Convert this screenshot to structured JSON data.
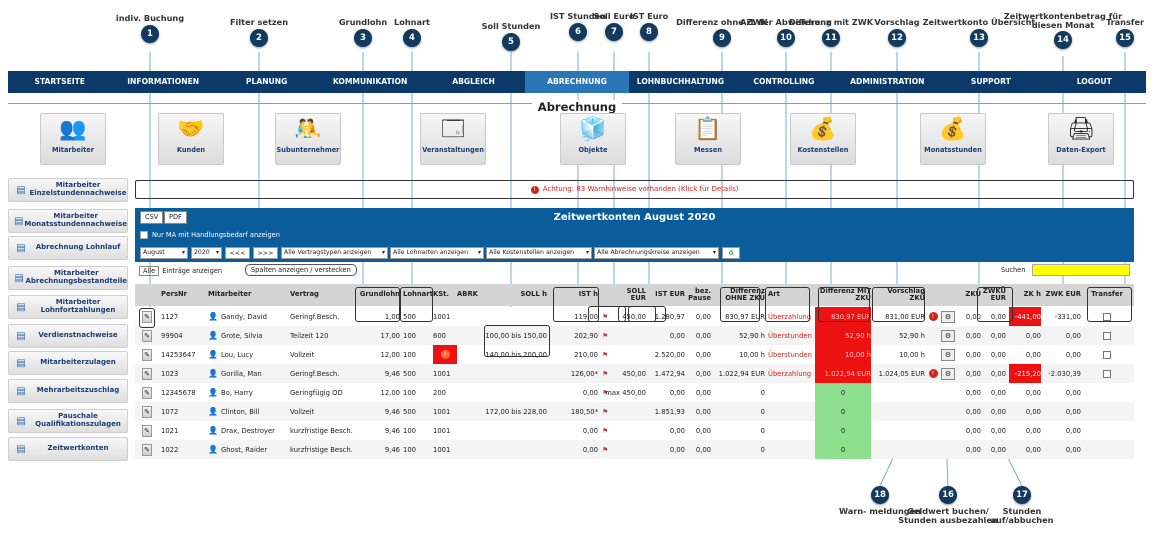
{
  "callouts": [
    {
      "num": "1",
      "label": "indiv. Buchung"
    },
    {
      "num": "2",
      "label": "Filter setzen"
    },
    {
      "num": "3",
      "label": "Grundlohn"
    },
    {
      "num": "4",
      "label": "Lohnart"
    },
    {
      "num": "5",
      "label": "Soll Stunden"
    },
    {
      "num": "6",
      "label": "IST Stunden"
    },
    {
      "num": "7",
      "label": "Soll Euro"
    },
    {
      "num": "8",
      "label": "IST Euro"
    },
    {
      "num": "9",
      "label": "Differenz ohne ZWK"
    },
    {
      "num": "10",
      "label": "Art der Abweichung"
    },
    {
      "num": "11",
      "label": "Differenz mit ZWK"
    },
    {
      "num": "12",
      "label": "Vorschlag"
    },
    {
      "num": "13",
      "label": "Zeitwertkonto Übersicht"
    },
    {
      "num": "14",
      "label": "Zeitwertkontenbetrag für diesen Monat"
    },
    {
      "num": "15",
      "label": "Transfer"
    },
    {
      "num": "16",
      "label": "Geldwert buchen/ Stunden ausbezahlen"
    },
    {
      "num": "17",
      "label": "Stunden auf/abbuchen"
    },
    {
      "num": "18",
      "label": "Warn- meldungen"
    }
  ],
  "nav": [
    "STARTSEITE",
    "INFORMATIONEN",
    "PLANUNG",
    "KOMMUNIKATION",
    "ABGLEICH",
    "ABRECHNUNG",
    "LOHNBUCHHALTUNG",
    "CONTROLLING",
    "ADMINISTRATION",
    "SUPPORT",
    "LOGOUT"
  ],
  "page_title": "Abrechnung",
  "modules": [
    {
      "label": "Mitarbeiter",
      "icon": "people-icon"
    },
    {
      "label": "Kunden",
      "icon": "handshake-icon"
    },
    {
      "label": "Subunternehmer",
      "icon": "partners-icon"
    },
    {
      "label": "Veranstaltungen",
      "icon": "events-icon"
    },
    {
      "label": "Objekte",
      "icon": "cube-icon"
    },
    {
      "label": "Messen",
      "icon": "board-icon"
    },
    {
      "label": "Kostenstellen",
      "icon": "money-icon"
    },
    {
      "label": "Monatsstunden",
      "icon": "money-icon"
    },
    {
      "label": "Daten-Export",
      "icon": "export-icon"
    }
  ],
  "sidebar": [
    "Mitarbeiter Einzelstundennachweise",
    "Mitarbeiter Monatsstundennachweise",
    "Abrechnung Lohnlauf",
    "Mitarbeiter Abrechnungsbestandteile",
    "Mitarbeiter Lohnfortzahlungen",
    "Verdienstnachweise",
    "Mitarbeiterzulagen",
    "Mehrarbeitszuschlag",
    "Pauschale Qualifikationszulagen",
    "Zeitwertkonten"
  ],
  "warning_text": "Achtung: 83 Warnhinweise vorhanden (Klick für Details)",
  "panel": {
    "title": "Zeitwertkonten August 2020",
    "csv": "CSV",
    "pdf": "PDF",
    "checkbox_label": "Nur MA mit Handlungsbedarf anzeigen",
    "filters": {
      "month": "August",
      "year": "2020",
      "prev": "<<<",
      "next": ">>>",
      "vertrag": "Alle Vertragstypen anzeigen",
      "lohnart": "Alle Lohnarten anzeigen",
      "kostenstelle": "Alle Kostenstellen anzeigen",
      "abrechnungskreis": "Alle Abrechnungskreise anzeigen"
    },
    "entries_select": "Alle",
    "entries_label": "Einträge anzeigen",
    "columns_toggle": "Spalten anzeigen / verstecken",
    "search_label": "Suchen"
  },
  "table": {
    "headers": {
      "persnr": "PersNr",
      "mitarbeiter": "Mitarbeiter",
      "vertrag": "Vertrag",
      "grundlohn": "Grundlohn",
      "lohnart": "Lohnart",
      "kst": "KSt.",
      "abrk": "ABRK",
      "soll_h": "SOLL h",
      "ist_h": "IST h",
      "soll_eur": "SOLL EUR",
      "ist_eur": "IST EUR",
      "pause": "bez. Pause",
      "diff_ohne": "Differenz OHNE ZKÜ",
      "art": "Art",
      "diff_mit": "Differenz MIT ZKÜ",
      "vorschlag": "Vorschlag ZKÜ",
      "zku": "ZKÜ",
      "zwku": "ZWKÜ EUR",
      "zk_h": "ZK h",
      "zwk_eur": "ZWK EUR",
      "transfer": "Transfer"
    },
    "rows": [
      {
        "persnr": "1127",
        "name": "Gandy, David",
        "vertrag": "Geringf.Besch.",
        "grundlohn": "1,00",
        "lohnart": "500",
        "kst": "1001",
        "soll_h": "",
        "ist_h": "119,00",
        "soll_eur": "450,00",
        "ist_eur": "1.280,97",
        "pause": "0,00",
        "diff_ohne": "830,97 EUR",
        "art": "Überzahlung",
        "diff_mit": "830,97 EUR",
        "diff_mit_style": "red",
        "vorschlag": "831,00 EUR",
        "zku": "0,00",
        "zwku": "0,00",
        "zk_h": "-441,00",
        "zk_h_style": "red",
        "zwk_eur": "-331,00",
        "flag": true,
        "warn": true,
        "action": true,
        "transfer": true
      },
      {
        "persnr": "99904",
        "name": "Grote, Silvia",
        "vertrag": "Teilzeit 120",
        "grundlohn": "17,00",
        "lohnart": "100",
        "kst": "600",
        "soll_h": "100,00 bis 150,00",
        "ist_h": "202,90",
        "soll_eur": "",
        "ist_eur": "0,00",
        "pause": "0,00",
        "diff_ohne": "52,90 h",
        "art": "Überstunden",
        "diff_mit": "52,90 h",
        "diff_mit_style": "red",
        "vorschlag": "52,90 h",
        "zku": "0,00",
        "zwku": "0,00",
        "zk_h": "0,00",
        "zwk_eur": "0,00",
        "flag": true,
        "warn": false,
        "action": true,
        "transfer": true
      },
      {
        "persnr": "14253647",
        "name": "Lou, Lucy",
        "vertrag": "Vollzeit",
        "grundlohn": "12,00",
        "lohnart": "100",
        "kst": "0001",
        "kst_style": "red",
        "soll_h": "140,00 bis 200,00",
        "ist_h": "210,00",
        "soll_eur": "",
        "ist_eur": "2.520,00",
        "pause": "0,00",
        "diff_ohne": "10,00 h",
        "art": "Überstunden",
        "diff_mit": "10,00 h",
        "diff_mit_style": "red",
        "vorschlag": "10,00 h",
        "zku": "0,00",
        "zwku": "0,00",
        "zk_h": "0,00",
        "zwk_eur": "0,00",
        "flag": true,
        "warn": false,
        "action": true,
        "transfer": true
      },
      {
        "persnr": "1023",
        "name": "Gorilla, Man",
        "vertrag": "Geringf.Besch.",
        "grundlohn": "9,46",
        "lohnart": "500",
        "kst": "1001",
        "soll_h": "",
        "ist_h": "126,00*",
        "soll_eur": "450,00",
        "ist_eur": "1.472,94",
        "pause": "0,00",
        "diff_ohne": "1.022,94 EUR",
        "art": "Überzahlung",
        "diff_mit": "1.022,94 EUR",
        "diff_mit_style": "red",
        "vorschlag": "1.024,05 EUR",
        "zku": "0,00",
        "zwku": "0,00",
        "zk_h": "-215,20",
        "zk_h_style": "red",
        "zwk_eur": "-2.030,39",
        "flag": true,
        "warn": true,
        "action": true,
        "transfer": true
      },
      {
        "persnr": "12345678",
        "name": "Bo, Harry",
        "vertrag": "Geringfügig OD",
        "grundlohn": "12,00",
        "lohnart": "100",
        "kst": "200",
        "soll_h": "",
        "ist_h": "0,00",
        "soll_eur": "max 450,00",
        "ist_eur": "0,00",
        "pause": "0,00",
        "diff_ohne": "0",
        "art": "",
        "diff_mit": "0",
        "diff_mit_style": "green",
        "vorschlag": "",
        "zku": "0,00",
        "zwku": "0,00",
        "zk_h": "0,00",
        "zwk_eur": "0,00",
        "flag": true,
        "warn": false,
        "action": false,
        "transfer": false
      },
      {
        "persnr": "1072",
        "name": "Clinton, Bill",
        "vertrag": "Vollzeit",
        "grundlohn": "9,46",
        "lohnart": "500",
        "kst": "1001",
        "soll_h": "172,00 bis 228,00",
        "ist_h": "180,50*",
        "soll_eur": "",
        "ist_eur": "1.851,93",
        "pause": "0,00",
        "diff_ohne": "0",
        "art": "",
        "diff_mit": "0",
        "diff_mit_style": "green",
        "vorschlag": "",
        "zku": "0,00",
        "zwku": "0,00",
        "zk_h": "0,00",
        "zwk_eur": "0,00",
        "flag": true,
        "warn": false,
        "action": false,
        "transfer": false
      },
      {
        "persnr": "1021",
        "name": "Drax, Destroyer",
        "vertrag": "kurzfristige Besch.",
        "grundlohn": "9,46",
        "lohnart": "100",
        "kst": "1001",
        "soll_h": "",
        "ist_h": "0,00",
        "soll_eur": "",
        "ist_eur": "0,00",
        "pause": "0,00",
        "diff_ohne": "0",
        "art": "",
        "diff_mit": "0",
        "diff_mit_style": "green",
        "vorschlag": "",
        "zku": "0,00",
        "zwku": "0,00",
        "zk_h": "0,00",
        "zwk_eur": "0,00",
        "flag": true,
        "warn": false,
        "action": false,
        "transfer": false
      },
      {
        "persnr": "1022",
        "name": "Ghost, Raider",
        "vertrag": "kurzfristige Besch.",
        "grundlohn": "9,46",
        "lohnart": "100",
        "kst": "1001",
        "soll_h": "",
        "ist_h": "0,00",
        "soll_eur": "",
        "ist_eur": "0,00",
        "pause": "0,00",
        "diff_ohne": "0",
        "art": "",
        "diff_mit": "0",
        "diff_mit_style": "green",
        "vorschlag": "",
        "zku": "0,00",
        "zwku": "0,00",
        "zk_h": "0,00",
        "zwk_eur": "0,00",
        "flag": true,
        "warn": false,
        "action": false,
        "transfer": false
      }
    ]
  },
  "colors": {
    "nav": "#0b3a6a",
    "nav_active": "#2a75b5",
    "panel": "#0b5c9a",
    "badge": "#123a5e",
    "warn": "#d0221d",
    "green": "#8ee08e",
    "search": "#ffff00"
  }
}
